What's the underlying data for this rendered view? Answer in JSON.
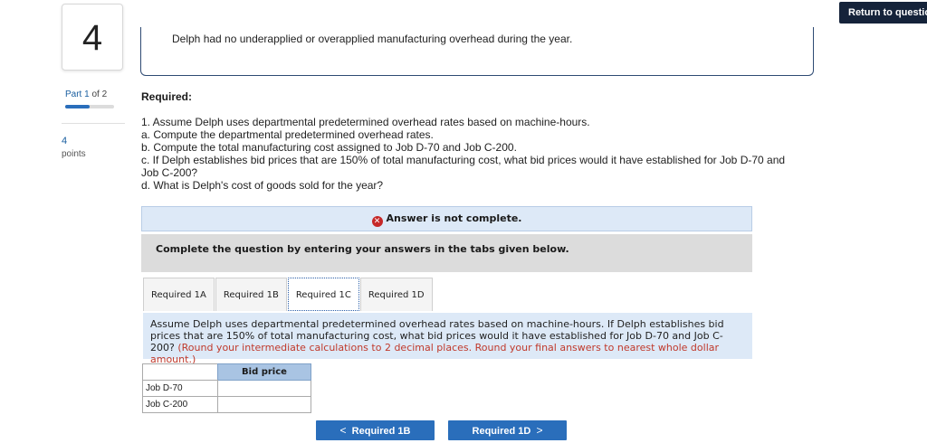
{
  "header": {
    "return_label": "Return to questio"
  },
  "question": {
    "number": "4"
  },
  "sidebar": {
    "part_label": "Part",
    "part_current": "1",
    "part_of": "of 2",
    "part_progress": 0.5,
    "points_value": "4",
    "points_label": "points"
  },
  "context": {
    "text": "Delph had no underapplied or overapplied manufacturing overhead during the year."
  },
  "required": {
    "heading": "Required:",
    "lines": [
      "1. Assume Delph uses departmental predetermined overhead rates based on machine-hours.",
      "a. Compute the departmental predetermined overhead rates.",
      "b. Compute the total manufacturing cost assigned to Job D-70 and Job C-200.",
      "c. If Delph establishes bid prices that are 150% of total manufacturing cost, what bid prices would it have established for Job D-70 and",
      "Job C-200?",
      "d. What is Delph's cost of goods sold for the year?"
    ]
  },
  "status": {
    "icon": "x-circle-icon",
    "text": "Answer is not complete."
  },
  "instruction": {
    "text": "Complete the question by entering your answers in the tabs given below."
  },
  "tabs": [
    {
      "label": "Required 1A",
      "active": false
    },
    {
      "label": "Required 1B",
      "active": false
    },
    {
      "label": "Required 1C",
      "active": true
    },
    {
      "label": "Required 1D",
      "active": false
    }
  ],
  "question_box": {
    "text": "Assume Delph uses departmental predetermined overhead rates based on machine-hours. If Delph establishes bid prices that are 150% of total manufacturing cost, what bid prices would it have established for Job D-70 and Job C-200? ",
    "note": "(Round your intermediate calculations to 2 decimal places. Round your final answers to nearest whole dollar amount.)"
  },
  "table": {
    "header": "Bid price",
    "rows": [
      {
        "label": "Job D-70",
        "value": ""
      },
      {
        "label": "Job C-200",
        "value": ""
      }
    ]
  },
  "nav": {
    "prev_label": "Required 1B",
    "next_label": "Required 1D"
  },
  "colors": {
    "accent": "#2a6ebb",
    "dark": "#15233a",
    "status_bg": "#dde9f7",
    "error": "#c62828"
  }
}
